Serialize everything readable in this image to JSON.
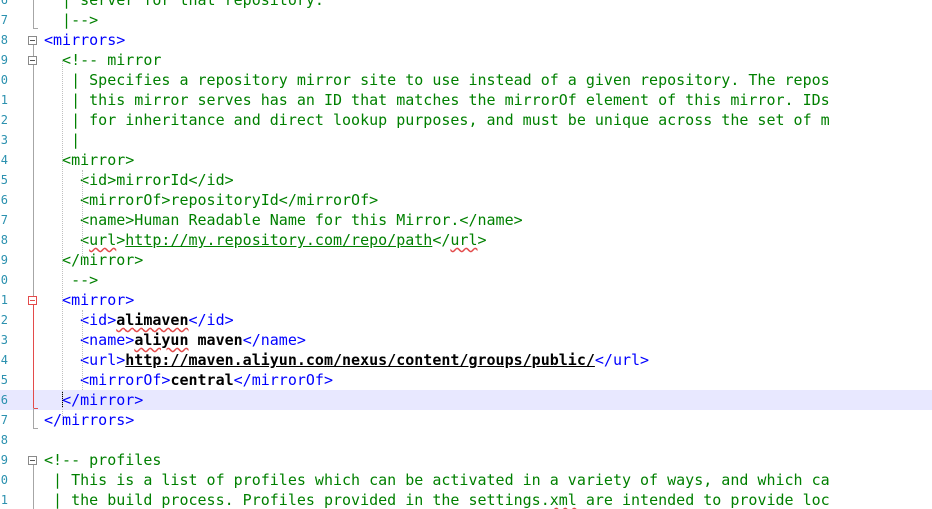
{
  "editor": {
    "line_numbers": [
      "6",
      "7",
      "8",
      "9",
      "0",
      "1",
      "2",
      "3",
      "4",
      "5",
      "6",
      "7",
      "8",
      "9",
      "0",
      "1",
      "2",
      "3",
      "4",
      "5",
      "6",
      "7",
      "8",
      "9",
      "0",
      "1"
    ],
    "current_line_index": 20
  },
  "lines": [
    [
      {
        "s": "c",
        "v": "  | server for that repository."
      }
    ],
    [
      {
        "s": "c",
        "v": "  |-->"
      }
    ],
    [
      {
        "s": "t",
        "v": "<mirrors>"
      }
    ],
    [
      {
        "s": "c",
        "v": "  <!-- mirror"
      }
    ],
    [
      {
        "s": "c",
        "v": "   | Specifies a repository mirror site to use instead of a given repository. The repos"
      }
    ],
    [
      {
        "s": "c",
        "v": "   | this mirror serves has an ID that matches the mirrorOf element of this mirror. IDs"
      }
    ],
    [
      {
        "s": "c",
        "v": "   | for inheritance and direct lookup purposes, and must be unique across the set of m"
      }
    ],
    [
      {
        "s": "c",
        "v": "   |"
      }
    ],
    [
      {
        "s": "c",
        "v": "  <mirror>"
      }
    ],
    [
      {
        "s": "c",
        "v": "    <id>mirrorId</id>"
      }
    ],
    [
      {
        "s": "c",
        "v": "    <mirrorOf>repositoryId</mirrorOf>"
      }
    ],
    [
      {
        "s": "c",
        "v": "    <name>Human Readable Name for this Mirror.</name>"
      }
    ],
    [
      {
        "s": "c",
        "v": "    <"
      },
      {
        "s": "c w",
        "v": "url"
      },
      {
        "s": "c",
        "v": ">"
      },
      {
        "s": "c u",
        "v": "http://my.repository.com/repo/path"
      },
      {
        "s": "c",
        "v": "</"
      },
      {
        "s": "c w",
        "v": "url"
      },
      {
        "s": "c",
        "v": ">"
      }
    ],
    [
      {
        "s": "c",
        "v": "  </mirror>"
      }
    ],
    [
      {
        "s": "c",
        "v": "   -->"
      }
    ],
    [
      {
        "s": "t",
        "v": "  <mirror>"
      }
    ],
    [
      {
        "s": "t",
        "v": "    <id>"
      },
      {
        "s": "b w",
        "v": "alimaven"
      },
      {
        "s": "t",
        "v": "</id>"
      }
    ],
    [
      {
        "s": "t",
        "v": "    <name>"
      },
      {
        "s": "b w",
        "v": "aliyun"
      },
      {
        "s": "b",
        "v": " maven"
      },
      {
        "s": "t",
        "v": "</name>"
      }
    ],
    [
      {
        "s": "t",
        "v": "    <url>"
      },
      {
        "s": "b u",
        "v": "http://maven.aliyun.com/nexus/content/groups/public/"
      },
      {
        "s": "t",
        "v": "</url>"
      }
    ],
    [
      {
        "s": "t",
        "v": "    <mirrorOf>"
      },
      {
        "s": "b",
        "v": "central"
      },
      {
        "s": "t",
        "v": "</mirrorOf>"
      }
    ],
    [
      {
        "s": "t",
        "v": "  </mirror>"
      }
    ],
    [
      {
        "s": "t",
        "v": "</mirrors>"
      }
    ],
    [
      {
        "s": "x",
        "v": ""
      }
    ],
    [
      {
        "s": "c",
        "v": "<!-- profiles"
      }
    ],
    [
      {
        "s": "c",
        "v": " | This is a list of profiles which can be activated in a variety of ways, and which ca"
      }
    ],
    [
      {
        "s": "c",
        "v": " | the build process. Profiles provided in the settings."
      },
      {
        "s": "c w",
        "v": "xml"
      },
      {
        "s": "c",
        "v": " are intended to provide loc"
      }
    ]
  ]
}
